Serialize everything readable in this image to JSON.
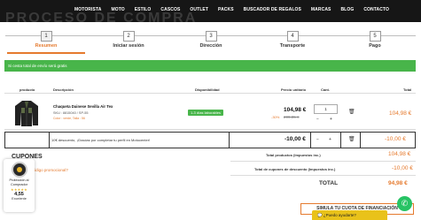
{
  "header": {
    "ghost_title": "PROCESO DE COMPRA",
    "nav": [
      "MOTORISTA",
      "MOTO",
      "ESTILO",
      "CASCOS",
      "OUTLET",
      "PACKS",
      "BUSCADOR DE REGALOS",
      "MARCAS",
      "BLOG",
      "CONTACTO"
    ]
  },
  "steps": [
    {
      "num": "1",
      "label": "Resumen"
    },
    {
      "num": "2",
      "label": "Iniciar sesión"
    },
    {
      "num": "3",
      "label": "Dirección"
    },
    {
      "num": "4",
      "label": "Transporte"
    },
    {
      "num": "5",
      "label": "Pago"
    }
  ],
  "banner": "Si cesta total de envío será gratis",
  "table": {
    "headers": {
      "product": "producto",
      "description": "Descripción",
      "availability": "Disponibilidad",
      "unit_price": "Precio unitario",
      "qty": "Cant.",
      "total": "Total"
    }
  },
  "item": {
    "name": "Chaqueta Dainese Sevilla Air Tex",
    "sku": "SKU : 8815040 / SP-55",
    "meta": "Color : verde, Talla : 56",
    "availability": "1-3 días laborables",
    "discount": "-30%",
    "price": "104,98 €",
    "old_price": "209,85 €",
    "qty": "1",
    "minus": "−",
    "plus": "+",
    "line_total": "104,98 €"
  },
  "coupon_row": {
    "text": "10€ descuento, ¡Gracias por completar tu perfil en Motocenter!",
    "price": "-10,00 €",
    "minus": "−",
    "plus": "+",
    "line_total": "-10,00 €"
  },
  "summary": {
    "products_label": "Total productos (Impuestos inc.)",
    "products_value": "104,98 €",
    "coupons_label": "Total de cupones de descuento (Impuestos inc.)",
    "coupons_value": "-10,00 €",
    "total_label": "TOTAL",
    "total_value": "94,98 €"
  },
  "coupons": {
    "title": "CUPONES",
    "promo_link": "¿Tiene un código promocional?"
  },
  "trust": {
    "line1": "Protección al",
    "line2": "Comprador",
    "stars": "★★★★★",
    "score": "4,55",
    "rating_word": "Excelente"
  },
  "simulate_button": "SIMULA TU CUOTA DE FINANCIACIÓN",
  "help_button": "¿Puedo ayudarte?",
  "colors": {
    "accent": "#e57a2e",
    "success": "#48b54a",
    "nav_bg": "#161616",
    "help": "#e9c21a",
    "whatsapp": "#27c364"
  }
}
